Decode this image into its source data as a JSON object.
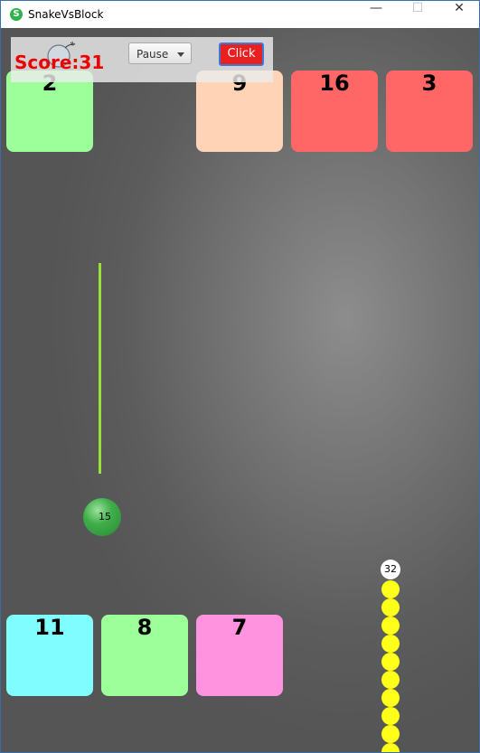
{
  "window": {
    "title": "SnakeVsBlock",
    "icon": "snake-app-icon",
    "minimize": "—",
    "maximize": "☐",
    "close": "✕"
  },
  "hud": {
    "score_text": "Score:31",
    "pause_select": "Pause",
    "click_label": "Click",
    "bomb_icon": "bomb-icon"
  },
  "blocks_top": [
    {
      "value": "2",
      "color": "#9cff9a"
    },
    {
      "value": "9",
      "color": "#ffd3b6"
    },
    {
      "value": "16",
      "color": "#ff6767"
    },
    {
      "value": "3",
      "color": "#ff6767"
    }
  ],
  "blocks_bottom": [
    {
      "value": "11",
      "color": "#7ffdff"
    },
    {
      "value": "8",
      "color": "#9cff9a"
    },
    {
      "value": "7",
      "color": "#ff93e0"
    }
  ],
  "ball": {
    "value": "15"
  },
  "snake": {
    "length_label": "32",
    "color": "#ffff1a"
  },
  "colors": {
    "score": "#ee0000",
    "wall": "#9be03a",
    "click_button": "#e82020"
  }
}
